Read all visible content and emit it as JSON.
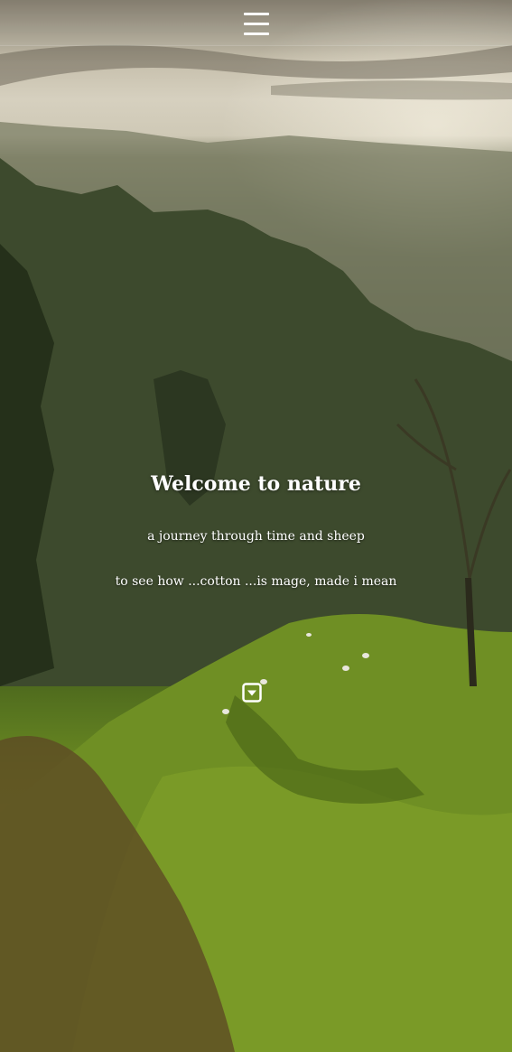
{
  "header": {
    "menu_icon": "hamburger-menu-icon"
  },
  "hero": {
    "title": "Welcome to nature",
    "line1": "a journey through time and sheep",
    "line2": "to see how ...cotton ...is mage, made i mean",
    "scroll_icon": "caret-down-square-icon"
  },
  "colors": {
    "text": "#ffffff",
    "grass": "#6c8c22",
    "forest": "#2f3a24",
    "sky": "#d6d0bf"
  }
}
